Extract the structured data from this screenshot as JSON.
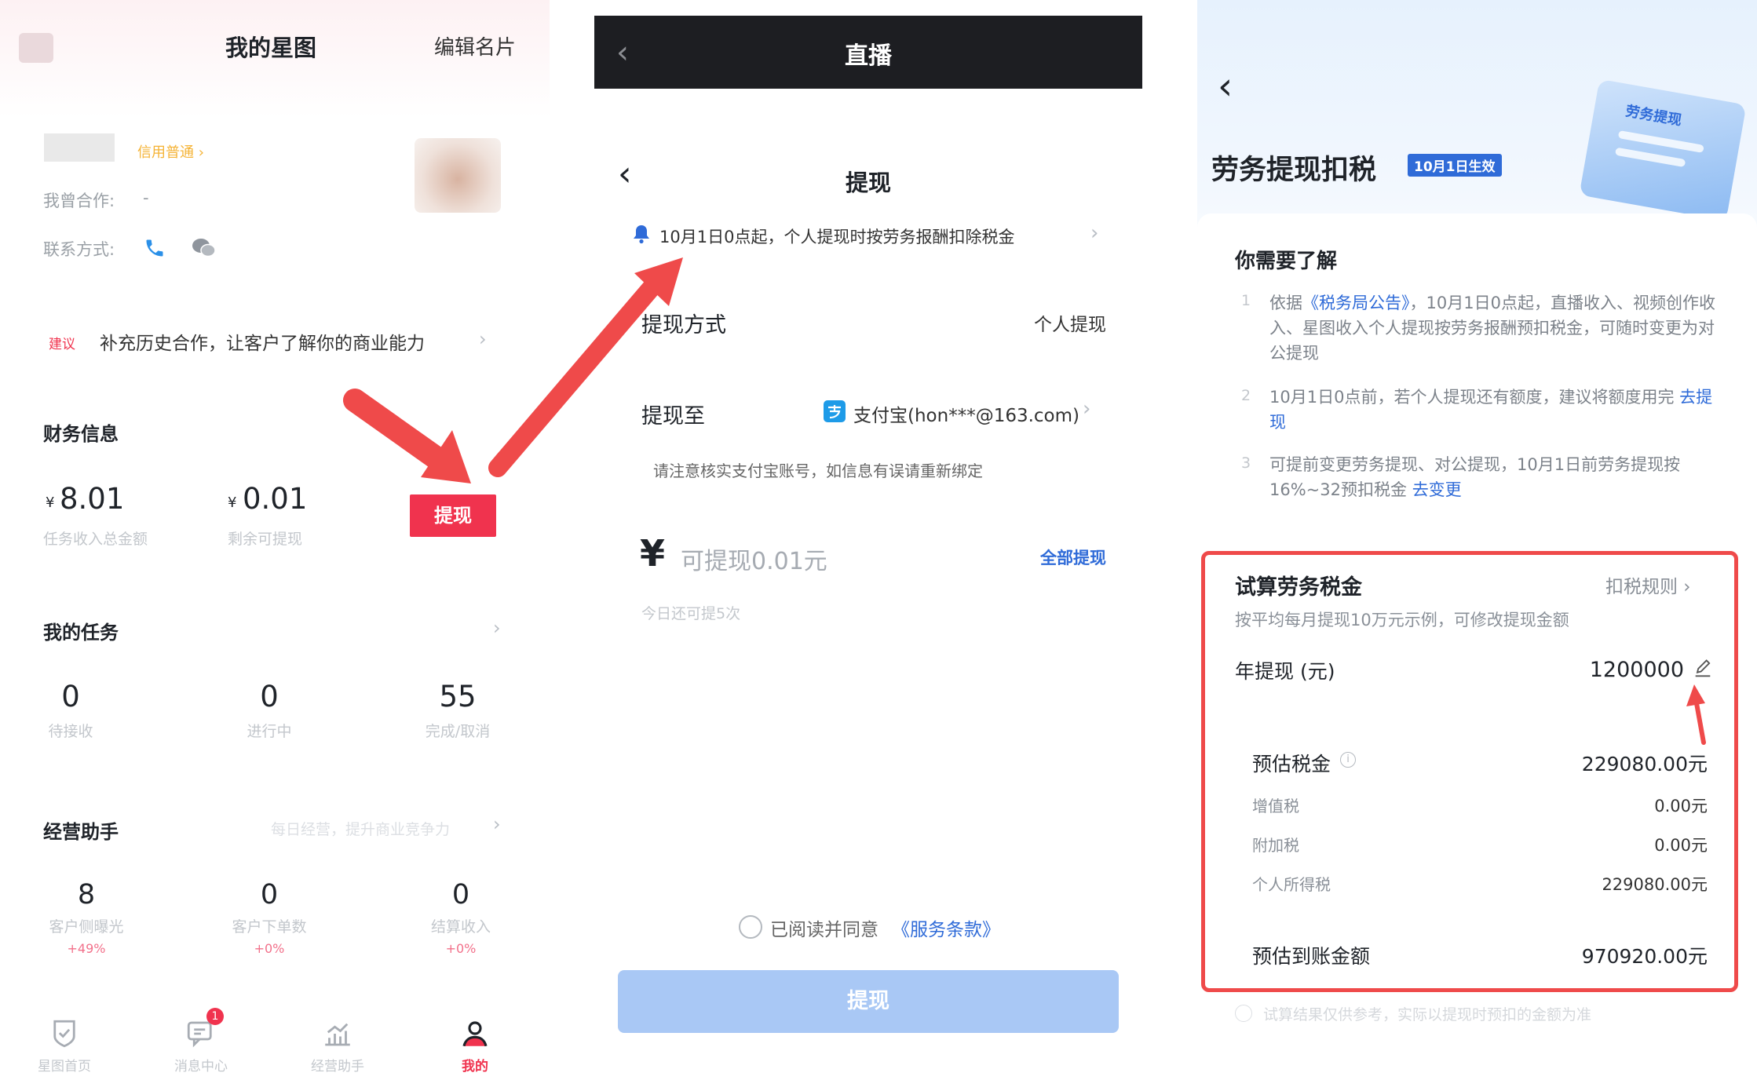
{
  "panel1": {
    "header": {
      "title": "我的星图",
      "edit_label": "编辑名片"
    },
    "profile": {
      "credit_badge": "信用普通 ›",
      "cooperated_label": "我曾合作:",
      "cooperated_value": "-",
      "contact_label": "联系方式:",
      "contact_icons": [
        "phone-icon",
        "wechat-icon"
      ]
    },
    "suggestion": {
      "tag": "建议",
      "text": "补充历史合作，让客户了解你的商业能力"
    },
    "finance": {
      "title": "财务信息",
      "total_prefix": "¥",
      "total_value": "8.01",
      "total_label": "任务收入总金额",
      "remaining_prefix": "¥",
      "remaining_value": "0.01",
      "remaining_label": "剩余可提现",
      "withdraw_button": "提现"
    },
    "tasks": {
      "title": "我的任务",
      "items": [
        {
          "value": "0",
          "label": "待接收"
        },
        {
          "value": "0",
          "label": "进行中"
        },
        {
          "value": "55",
          "label": "完成/取消"
        }
      ]
    },
    "assistant": {
      "title": "经营助手",
      "hint": "每日经营，提升商业竞争力",
      "items": [
        {
          "value": "8",
          "label": "客户侧曝光",
          "change": "+49%"
        },
        {
          "value": "0",
          "label": "客户下单数",
          "change": "+0%"
        },
        {
          "value": "0",
          "label": "结算收入",
          "change": "+0%"
        }
      ]
    },
    "tabbar": {
      "items": [
        {
          "label": "星图首页",
          "icon": "shield-check-icon"
        },
        {
          "label": "消息中心",
          "icon": "message-icon",
          "badge": "1"
        },
        {
          "label": "经营助手",
          "icon": "chart-icon"
        },
        {
          "label": "我的",
          "icon": "person-icon"
        }
      ]
    }
  },
  "panel2": {
    "topbar": {
      "title": "直播"
    },
    "header": {
      "title": "提现"
    },
    "notice": "10月1日0点起，个人提现时按劳务报酬扣除税金",
    "method": {
      "label": "提现方式",
      "value": "个人提现"
    },
    "target": {
      "label": "提现至",
      "value": "支付宝(hon***@163.com)"
    },
    "tip": "请注意核实支付宝账号，如信息有误请重新绑定",
    "amount": {
      "currency": "¥",
      "placeholder": "可提现0.01元",
      "all_label": "全部提现"
    },
    "remaining_times": "今日还可提5次",
    "agreement": {
      "prefix": "已阅读并同意",
      "link": "《服务条款》"
    },
    "submit_button": "提现"
  },
  "panel3": {
    "header": {
      "title": "劳务提现扣税",
      "badge": "10月1日生效",
      "illustration_text": "劳务提现"
    },
    "notice": {
      "title": "你需要了解",
      "items": [
        {
          "num": "1",
          "before": "依据",
          "link": "《税务局公告》",
          "after": "，10月1日0点起，直播收入、视频创作收入、星图收入个人提现按劳务报酬预扣税金，可随时变更为对公提现"
        },
        {
          "num": "2",
          "before": "10月1日0点前，若个人提现还有额度，建议将额度用完",
          "link": "去提现",
          "after": ""
        },
        {
          "num": "3",
          "before": "可提前变更劳务提现、对公提现，10月1日前劳务提现按16%~32预扣税金",
          "link": "去变更",
          "after": ""
        }
      ]
    },
    "calc": {
      "title": "试算劳务税金",
      "rules_link": "扣税规则 ›",
      "subtitle": "按平均每月提现10万元示例，可修改提现金额",
      "annual_label": "年提现 (元)",
      "annual_value": "1200000",
      "est_tax_label": "预估税金",
      "est_tax_value": "229080.00元",
      "rows": [
        {
          "label": "增值税",
          "value": "0.00元"
        },
        {
          "label": "附加税",
          "value": "0.00元"
        },
        {
          "label": "个人所得税",
          "value": "229080.00元"
        }
      ],
      "net_label": "预估到账金额",
      "net_value": "970920.00元"
    },
    "footnote": "试算结果仅供参考，实际以提现时预扣的金额为准"
  },
  "colors": {
    "accent_red": "#f0334e",
    "annotation_red": "#ef4a4a",
    "link_blue": "#2f6bd8",
    "disabled_button": "#a9c8f5",
    "dark_bar": "#1d1e22"
  }
}
